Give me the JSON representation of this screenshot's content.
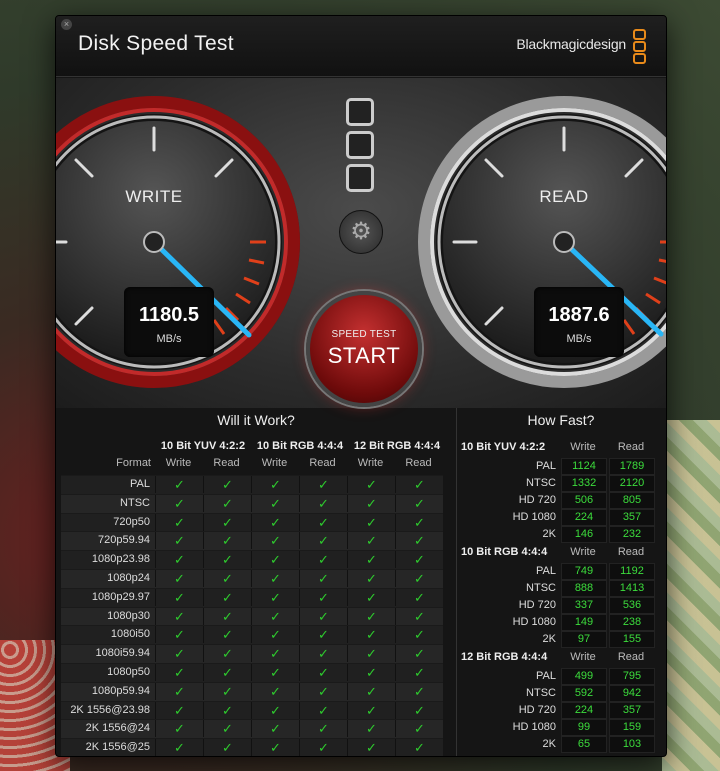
{
  "window": {
    "title": "Disk Speed Test",
    "brand": "Blackmagicdesign",
    "close_glyph": "×"
  },
  "colors": {
    "accent_red": "#c43030",
    "needle_blue": "#29b6f6",
    "check_green": "#2ecc2e",
    "value_green": "#3cdc3c",
    "brand_orange": "#e88a1a"
  },
  "gauges": {
    "write": {
      "label": "WRITE",
      "value": "1180.5",
      "unit": "MB/s"
    },
    "read": {
      "label": "READ",
      "value": "1887.6",
      "unit": "MB/s"
    }
  },
  "controls": {
    "settings_icon": "gear-icon",
    "start_top": "SPEED TEST",
    "start_main": "START"
  },
  "will_it_work": {
    "title": "Will it Work?",
    "format_header": "Format",
    "groups": [
      "10 Bit YUV 4:2:2",
      "10 Bit RGB 4:4:4",
      "12 Bit RGB 4:4:4"
    ],
    "subheaders": [
      "Write",
      "Read",
      "Write",
      "Read",
      "Write",
      "Read"
    ],
    "check_glyph": "✓",
    "formats": [
      "PAL",
      "NTSC",
      "720p50",
      "720p59.94",
      "1080p23.98",
      "1080p24",
      "1080p29.97",
      "1080p30",
      "1080i50",
      "1080i59.94",
      "1080p50",
      "1080p59.94",
      "2K 1556@23.98",
      "2K 1556@24",
      "2K 1556@25"
    ]
  },
  "how_fast": {
    "title": "How Fast?",
    "col_write": "Write",
    "col_read": "Read",
    "groups": [
      {
        "name": "10 Bit YUV 4:2:2",
        "rows": [
          {
            "format": "PAL",
            "write": "1124",
            "read": "1789"
          },
          {
            "format": "NTSC",
            "write": "1332",
            "read": "2120"
          },
          {
            "format": "HD 720",
            "write": "506",
            "read": "805"
          },
          {
            "format": "HD 1080",
            "write": "224",
            "read": "357"
          },
          {
            "format": "2K",
            "write": "146",
            "read": "232"
          }
        ]
      },
      {
        "name": "10 Bit RGB 4:4:4",
        "rows": [
          {
            "format": "PAL",
            "write": "749",
            "read": "1192"
          },
          {
            "format": "NTSC",
            "write": "888",
            "read": "1413"
          },
          {
            "format": "HD 720",
            "write": "337",
            "read": "536"
          },
          {
            "format": "HD 1080",
            "write": "149",
            "read": "238"
          },
          {
            "format": "2K",
            "write": "97",
            "read": "155"
          }
        ]
      },
      {
        "name": "12 Bit RGB 4:4:4",
        "rows": [
          {
            "format": "PAL",
            "write": "499",
            "read": "795"
          },
          {
            "format": "NTSC",
            "write": "592",
            "read": "942"
          },
          {
            "format": "HD 720",
            "write": "224",
            "read": "357"
          },
          {
            "format": "HD 1080",
            "write": "99",
            "read": "159"
          },
          {
            "format": "2K",
            "write": "65",
            "read": "103"
          }
        ]
      }
    ]
  }
}
